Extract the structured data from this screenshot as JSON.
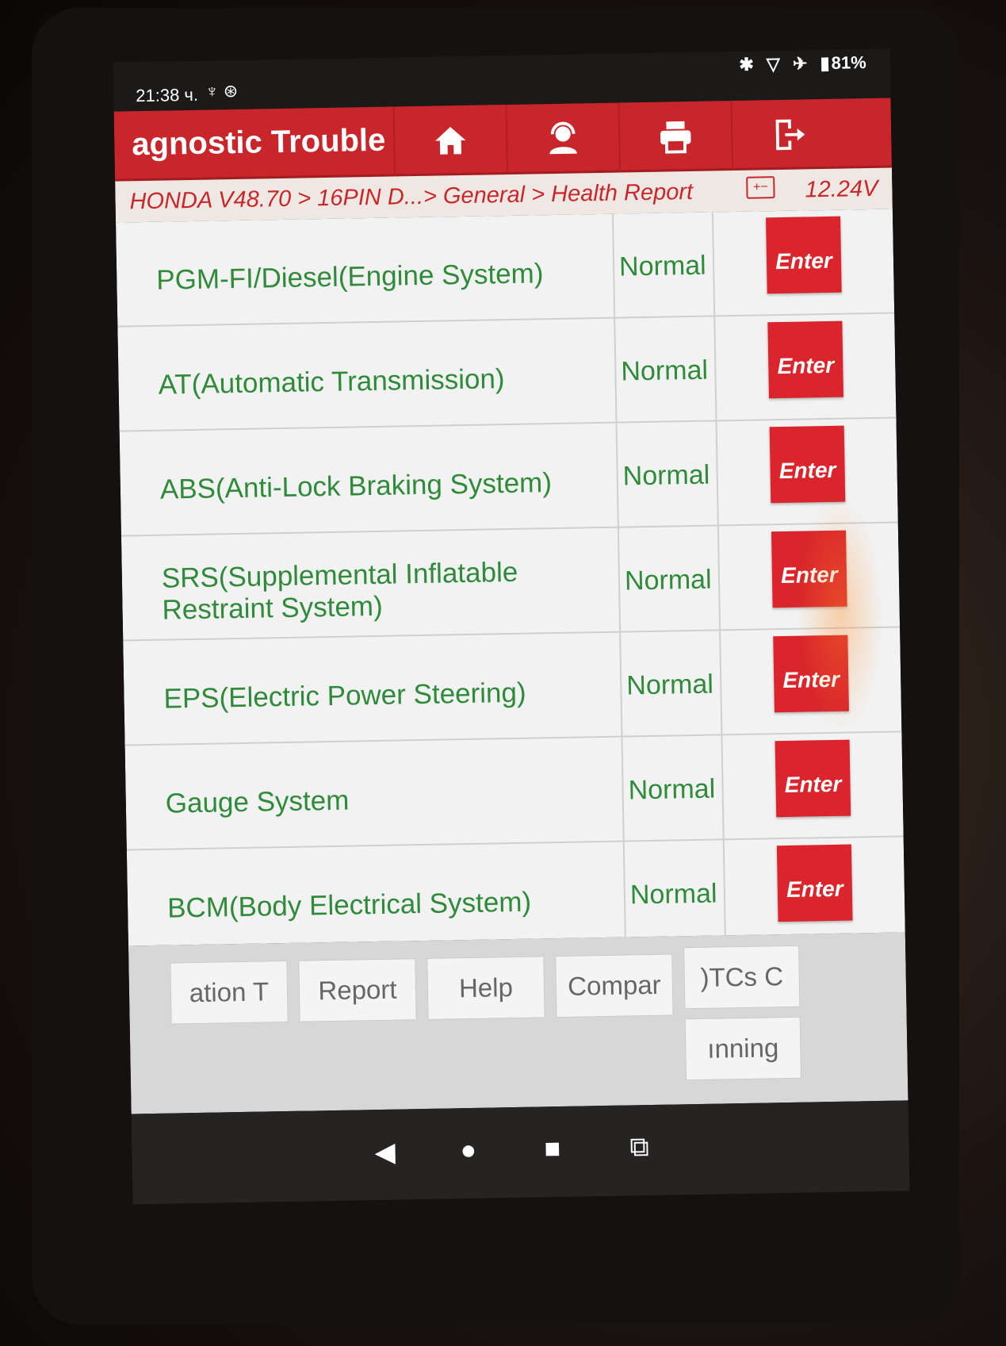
{
  "status_bar": {
    "time": "21:38 ч.",
    "left_icons": "♆ ⊛",
    "battery": "81%"
  },
  "header": {
    "title": "agnostic Trouble",
    "buttons": [
      {
        "name": "home",
        "icon": "home-icon"
      },
      {
        "name": "support",
        "icon": "user-support-icon"
      },
      {
        "name": "print",
        "icon": "printer-icon"
      },
      {
        "name": "exit",
        "icon": "exit-icon"
      }
    ]
  },
  "breadcrumb": {
    "path": "HONDA V48.70 > 16PIN D...> General > Health Report",
    "battery_symbol": "+−",
    "voltage": "12.24V"
  },
  "systems": [
    {
      "name": "PGM-FI/Diesel(Engine System)",
      "status": "Normal",
      "action": "Enter"
    },
    {
      "name": "AT(Automatic Transmission)",
      "status": "Normal",
      "action": "Enter"
    },
    {
      "name": "ABS(Anti-Lock Braking System)",
      "status": "Normal",
      "action": "Enter"
    },
    {
      "name": "SRS(Supplemental Inflatable Restraint System)",
      "status": "Normal",
      "action": "Enter"
    },
    {
      "name": "EPS(Electric Power Steering)",
      "status": "Normal",
      "action": "Enter"
    },
    {
      "name": "Gauge System",
      "status": "Normal",
      "action": "Enter"
    },
    {
      "name": "BCM(Body Electrical System)",
      "status": "Normal",
      "action": "Enter"
    }
  ],
  "bottom_buttons": {
    "information": "ation    T",
    "report": "Report",
    "help": "Help",
    "compare": "Compar",
    "dtcs": ")TCs    C",
    "scanning": "ınning"
  },
  "colors": {
    "header_red": "#c9262c",
    "status_green": "#2f8a3a",
    "enter_red": "#d9252b"
  }
}
